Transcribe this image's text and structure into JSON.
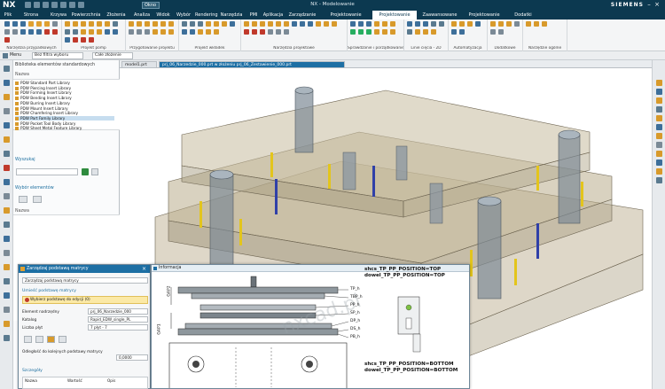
{
  "app": {
    "logo": "NX",
    "title": "NX - Modelowanie",
    "brand": "SIEMENS",
    "window_menu": "Okno"
  },
  "tabs": [
    "Plik",
    "Strona główna",
    "Krzywa",
    "Powierzchnia",
    "Złożenia",
    "Analiza",
    "Widok",
    "Wybór",
    "Rendering",
    "Narzędzia",
    "PMI",
    "Aplikacja",
    "Zarządzanie",
    "Projektowanie wkładek",
    "Projektowanie formy",
    "Zaawansowane płyty",
    "Projektowanie form",
    "Dodatki"
  ],
  "active_tab_index": 14,
  "ribbon_groups": [
    {
      "label": "Narzędzia przypadkowych",
      "icons": [
        "#3d6f9a",
        "#e0a030",
        "#7b8a96",
        "#3d6f9a",
        "#c0392b"
      ]
    },
    {
      "label": "Projekt pomp",
      "icons": [
        "#d89a2b",
        "#d89a2b",
        "#5a7a8f",
        "#d89a2b",
        "#3d6f9a",
        "#c0392b"
      ]
    },
    {
      "label": "Przygotowanie projektu",
      "icons": [
        "#d89a2b",
        "#d89a2b",
        "#7b8a96",
        "#d89a2b"
      ]
    },
    {
      "label": "Projekt wkładek",
      "icons": [
        "#5a7a8f",
        "#d89a2b",
        "#3d6f9a",
        "#d89a2b"
      ]
    },
    {
      "label": "Narzędzia projektowe",
      "icons": [
        "#d89a2b",
        "#d89a2b",
        "#3d6f9a",
        "#d89a2b",
        "#c0392b",
        "#7b8a96"
      ]
    },
    {
      "label": "Sprawdzanie i porządkowanie",
      "icons": [
        "#3d6f9a",
        "#d89a2b",
        "#27ae60",
        "#d89a2b"
      ]
    },
    {
      "label": "Linie cięcia - 2D",
      "icons": [
        "#3d6f9a",
        "#5a7a8f",
        "#d89a2b"
      ]
    },
    {
      "label": "Automatyzacja",
      "icons": [
        "#d89a2b",
        "#3d6f9a"
      ]
    },
    {
      "label": "Dodatkowe",
      "icons": [
        "#d89a2b",
        "#7b8a96"
      ]
    },
    {
      "label": "Narzędzie ogólne",
      "icons": [
        "#d89a2b"
      ]
    }
  ],
  "selection_bar": {
    "menu_label": "Menu",
    "filter_value": "Bez filtra wyboru",
    "scope_value": "Całe złożenie"
  },
  "panel": {
    "title": "Biblioteka elementów standardowych",
    "name_header": "Nazwa",
    "libraries": [
      "PDW Standard Part Library",
      "PDW Piercing Insert Library",
      "PDW Forming Insert Library",
      "PDW Bending Insert Library",
      "PDW Burring Insert Library",
      "PDW Mount Insert Library",
      "PDW Chamfering Insert Library",
      "PDW Part Family Library",
      "PDW Pocket Tool Body Library",
      "PDW Sheet Metal Feature Library"
    ],
    "selected_library_index": 7,
    "search_section": "Wyszukaj",
    "member_section": "Wybór elementów",
    "member_header": "Nazwa"
  },
  "file_tabs": [
    {
      "label": "model1.prt"
    },
    {
      "label": "prj_06_Narzedzie_000.prt w złożeniu prj_06_Zestawienie_000.prt"
    }
  ],
  "active_file_tab": 1,
  "dialog": {
    "title": "Zarządzaj podstawą matrycy",
    "main_option": "Zarządzaj podstawą matrycy",
    "section_title": "Umieść podstawę matrycy",
    "warning": "Wybierz podstawę do edycji (0)",
    "rows": [
      {
        "label": "Element nadrzędny",
        "value": "prj_06_Narzedzie_000"
      },
      {
        "label": "Katalog",
        "value": "Rapid_EDW_single_PL"
      },
      {
        "label": "Liczba płyt",
        "value": "7 płyt - 7"
      }
    ],
    "offset_label": "Odległość do kolejnych podstawy matrycy",
    "offset_value": "0,0000",
    "details_section": "Szczegóły",
    "details_headers": [
      "Nazwa",
      "Wartość",
      "Opis"
    ]
  },
  "info_window": {
    "title": "Informacja",
    "notes_top": [
      "shcs_TP_PP_POSITION=TOP",
      "dowel_TP_PP_POSITION=TOP"
    ],
    "notes_bottom": [
      "shcs_TP_PP_POSITION=BOTTOM",
      "dowel_TP_PP_POSITION=BOTTOM"
    ],
    "plate_labels": [
      "TP_h",
      "TBP_h",
      "PP_h",
      "SP_h",
      "DP_h",
      "DS_h",
      "PB_h"
    ],
    "gap_labels": [
      "GAP2",
      "GAP1"
    ],
    "watermark": "nxcad.pl"
  }
}
